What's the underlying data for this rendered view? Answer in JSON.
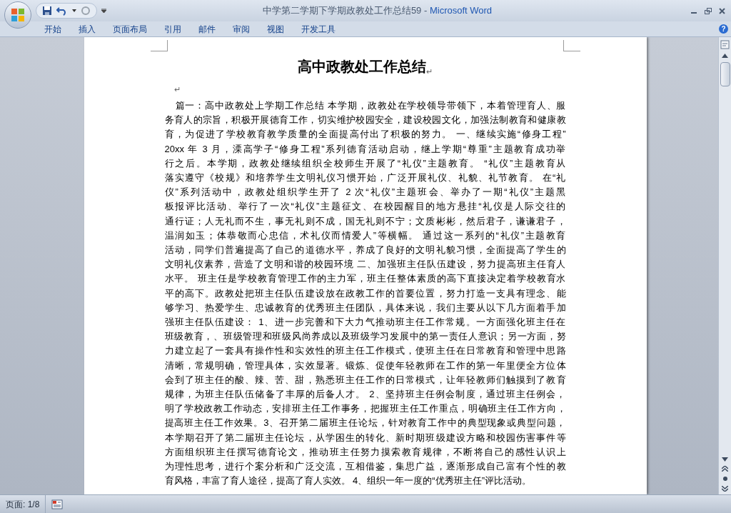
{
  "window": {
    "title": "中学第二学期下学期政教处工作总结59",
    "separator": " - ",
    "app": "Microsoft Word"
  },
  "ribbon_tabs": [
    {
      "label": "开始",
      "selected": false
    },
    {
      "label": "插入",
      "selected": false
    },
    {
      "label": "页面布局",
      "selected": false
    },
    {
      "label": "引用",
      "selected": false
    },
    {
      "label": "邮件",
      "selected": false
    },
    {
      "label": "审阅",
      "selected": false
    },
    {
      "label": "视图",
      "selected": false
    },
    {
      "label": "开发工具",
      "selected": false
    }
  ],
  "help": "?",
  "document": {
    "title": "高中政教处工作总结",
    "title_mark": "↵",
    "blank_paragraph": "↵",
    "lines": [
      "篇一：高中政教处上学期工作总结  本学期，政教处在学校领导带领下，本着管理育人、服",
      "务育人的宗旨，积极开展德育工作，切实维护校园安全，建设校园文化，加强法制教育和健康教",
      "育，为促进了学校教育教学质量的全面提高付出了积极的努力。 一、继续实施“修身工程”",
      "20xx 年 3 月，溧高学子“修身工程”系列德育活动启动，继上学期“尊重”主题教育成功举",
      "行之后。本学期，政教处继续组织全校师生开展了“礼仪”主题教育。 “礼仪”主题教育从",
      "落实遵守《校规》和培养学生文明礼仪习惯开始，广泛开展礼仪、礼貌、礼节教育。 在“礼",
      "仪”系列活动中，政教处组织学生开了 2 次“礼仪”主题班会、举办了一期“礼仪”主题黑",
      "板报评比活动、举行了一次“礼仪”主题征文、在校园醒目的地方悬挂“礼仪是人际交往的",
      "通行证；人无礼而不生，事无礼则不成，国无礼则不宁；文质彬彬，然后君子，谦谦君子，",
      "温润如玉；体恭敬而心忠信，术礼仪而情爱人”等横幅。 通过这一系列的“礼仪”主题教育",
      "活动，同学们普遍提高了自己的道德水平，养成了良好的文明礼貌习惯，全面提高了学生的",
      "文明礼仪素养，营造了文明和谐的校园环境 二、加强班主任队伍建设，努力提高班主任育人",
      "水平。 班主任是学校教育管理工作的主力军，班主任整体素质的高下直接决定着学校教育水",
      "平的高下。政教处把班主任队伍建设放在政教工作的首要位置，努力打造一支具有理念、能",
      "够学习、热爱学生、忠诚教育的优秀班主任团队，具体来说，我们主要从以下几方面着手加",
      "强班主任队伍建设： 1、进一步完善和下大力气推动班主任工作常规。一方面强化班主任在",
      "班级教育，、班级管理和班级风尚养成以及班级学习发展中的第一责任人意识；另一方面，努",
      "力建立起了一套具有操作性和实效性的班主任工作模式，使班主任在日常教育和管理中思路",
      "清晰，常规明确，管理具体，实效显著。锻炼、促使年轻教师在工作的第一年里便全方位体",
      "会到了班主任的酸、辣、苦、甜，熟悉班主任工作的日常模式，让年轻教师们触摸到了教育",
      "规律，为班主任队伍储备了丰厚的后备人才。 2、坚持班主任例会制度，通过班主任例会，",
      "明了学校政教工作动态，安排班主任工作事务，把握班主任工作重点，明确班主任工作方向，",
      "提高班主任工作效果。3、召开第二届班主任论坛，针对教育工作中的典型现象或典型问题，",
      "本学期召开了第二届班主任论坛，从学困生的转化、新时期班级建设方略和校园伤害事件等",
      "方面组织班主任撰写德育论文，推动班主任努力摸索教育规律，不断将自己的感性认识上",
      "为理性思考，进行个案分析和广泛交流，互相借鉴，集思广益，逐渐形成自己富有个性的教",
      "育风格，丰富了育人途径，提高了育人实效。 4、组织一年一度的“优秀班主任”评比活动。"
    ]
  },
  "status_bar": {
    "page": "页面: 1/8"
  }
}
